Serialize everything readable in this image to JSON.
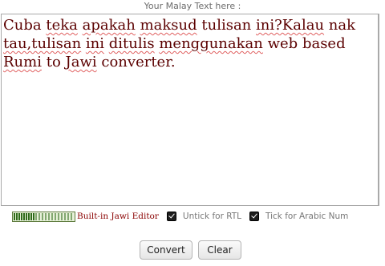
{
  "heading": "Your Malay Text here :",
  "textarea": {
    "words": [
      {
        "t": "Cuba",
        "sq": false
      },
      {
        "t": "teka",
        "sq": true
      },
      {
        "t": "apakah",
        "sq": true
      },
      {
        "t": "maksud",
        "sq": true
      },
      {
        "t": "tulisan",
        "sq": false
      },
      {
        "t": "ini?Kalau",
        "sq": true
      },
      {
        "t": "nak",
        "sq": false
      },
      {
        "t": "tau,tulisan",
        "sq": true
      },
      {
        "t": "ini",
        "sq": true
      },
      {
        "t": "ditulis",
        "sq": true
      },
      {
        "t": "menggunakan",
        "sq": true
      },
      {
        "t": "web",
        "sq": false
      },
      {
        "t": "based",
        "sq": false
      },
      {
        "t": "Rumi",
        "sq": true
      },
      {
        "t": "to",
        "sq": false
      },
      {
        "t": "Jawi",
        "sq": true
      },
      {
        "t": "converter.",
        "sq": false
      }
    ]
  },
  "toolbar": {
    "editor_link": "Built-in Jawi Editor",
    "rtl_label": "Untick for RTL",
    "arabic_num_label": "Tick for Arabic Num",
    "rtl_checked": true,
    "arabic_num_checked": true
  },
  "buttons": {
    "convert": "Convert",
    "clear": "Clear"
  },
  "colors": {
    "text": "#5b0000",
    "link": "#8a0000",
    "label": "#777777",
    "spell_underline": "#e06060"
  }
}
